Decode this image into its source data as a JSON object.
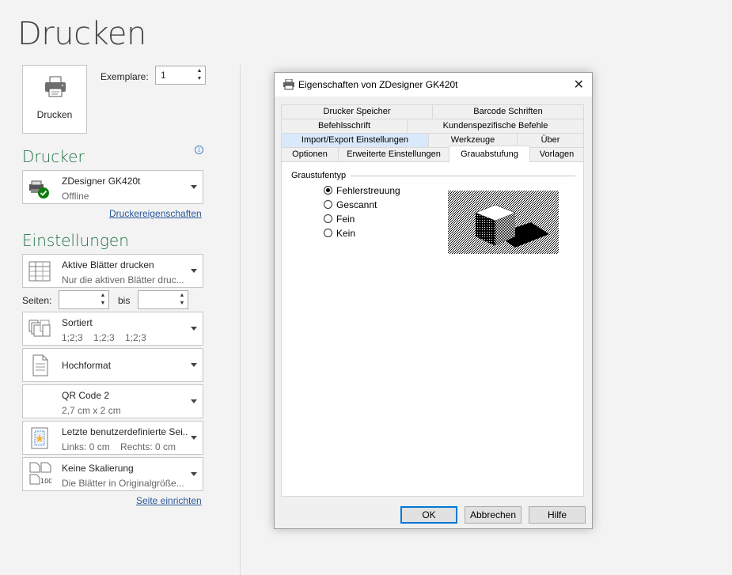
{
  "backstage": {
    "title": "Drucken",
    "print_button_label": "Drucken",
    "copies_label": "Exemplare:",
    "copies_value": "1",
    "printer_heading": "Drucker",
    "printer": {
      "name": "ZDesigner GK420t",
      "status": "Offline"
    },
    "printer_properties_link": "Druckereigenschaften",
    "settings_heading": "Einstellungen",
    "settings": {
      "what": {
        "line1": "Aktive Blätter drucken",
        "line2": "Nur die aktiven Blätter druc..."
      },
      "pages_label": "Seiten:",
      "to_label": "bis",
      "collate": {
        "line1": "Sortiert",
        "line2": "1;2;3    1;2;3    1;2;3"
      },
      "orientation": {
        "line1": "Hochformat"
      },
      "paper": {
        "line1": "QR Code 2",
        "line2": "2,7 cm x 2 cm"
      },
      "margins": {
        "line1": "Letzte benutzerdefinierte Sei...",
        "line2": "Links: 0 cm    Rechts: 0 cm"
      },
      "scaling": {
        "line1": "Keine Skalierung",
        "line2": "Die Blätter in Originalgröße..."
      }
    },
    "page_setup_link": "Seite einrichten"
  },
  "dialog": {
    "title": "Eigenschaften von ZDesigner GK420t",
    "tabs_row1": [
      "Drucker Speicher",
      "Barcode Schriften"
    ],
    "tabs_row2": [
      "Befehlsschrift",
      "Kundenspezifische Befehle"
    ],
    "tabs_row3": [
      "Import/Export Einstellungen",
      "Werkzeuge",
      "Über"
    ],
    "tabs_row4": [
      "Optionen",
      "Erweiterte Einstellungen",
      "Grauabstufung",
      "Vorlagen"
    ],
    "active_tab": "Grauabstufung",
    "group_label": "Graustufentyp",
    "options": [
      "Fehlerstreuung",
      "Gescannt",
      "Fein",
      "Kein"
    ],
    "selected_option": "Fehlerstreuung",
    "buttons": {
      "ok": "OK",
      "cancel": "Abbrechen",
      "help": "Hilfe"
    }
  }
}
